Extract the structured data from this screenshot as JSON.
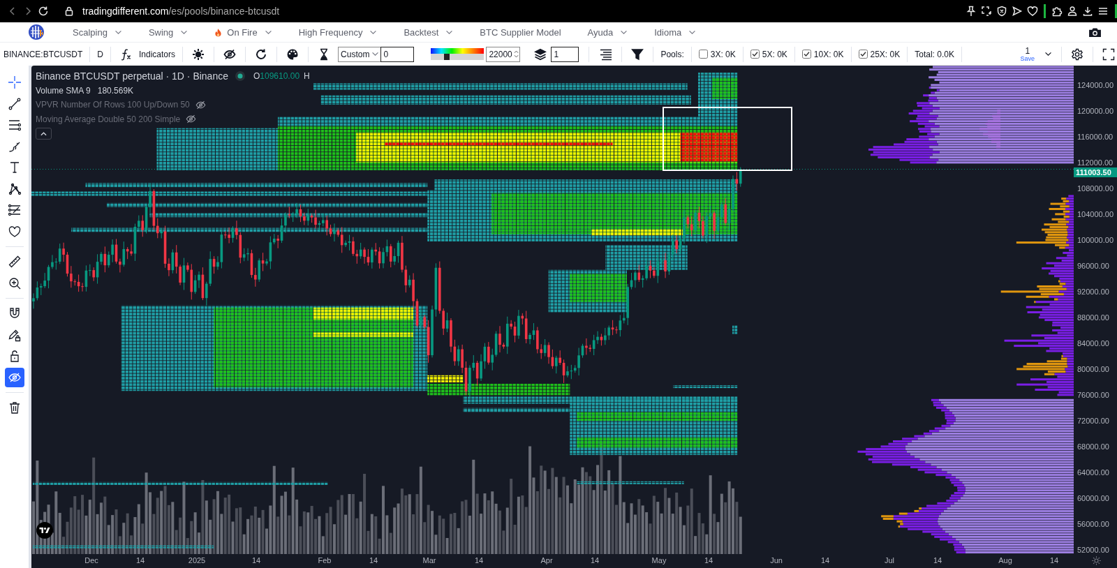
{
  "browser": {
    "url_host": "tradingdifferent.com",
    "url_path": "/es/pools/binance-btcusdt"
  },
  "nav": {
    "items": [
      {
        "label": "Scalping",
        "kind": "plain",
        "dropdown": true
      },
      {
        "label": "Swing",
        "kind": "plain",
        "dropdown": true
      },
      {
        "label": "On Fire",
        "kind": "hot",
        "dropdown": true
      },
      {
        "label": "High Frequency",
        "kind": "plain",
        "dropdown": true
      },
      {
        "label": "Backtest",
        "kind": "plain",
        "dropdown": true
      },
      {
        "label": "BTC Supplier Model",
        "kind": "plain",
        "dropdown": false
      },
      {
        "label": "Ayuda",
        "kind": "plain",
        "dropdown": true
      },
      {
        "label": "Idioma",
        "kind": "plain",
        "dropdown": true
      }
    ]
  },
  "toolbar": {
    "symbol": "BINANCE:BTCUSDT",
    "interval": "D",
    "indicators": "Indicators",
    "range_mode": "Custom",
    "range_value": "0",
    "color_scale": {
      "level": 0.3
    },
    "threshold": "22000",
    "layers": "1",
    "pools_label": "Pools:",
    "pools": [
      {
        "label": "3X: 0K",
        "checked": false
      },
      {
        "label": "5X: 0K",
        "checked": true
      },
      {
        "label": "10X: 0K",
        "checked": true
      },
      {
        "label": "25X: 0K",
        "checked": true
      }
    ],
    "total": "Total: 0.0K",
    "layout": {
      "number": "1",
      "action": "Save"
    }
  },
  "drawing_toolbar": {
    "groups": [
      {
        "tools": [
          {
            "kind": "crosshair",
            "selected": true
          },
          {
            "kind": "trend-line",
            "selected": false
          },
          {
            "kind": "parallel-lines",
            "selected": false
          },
          {
            "kind": "brush",
            "selected": false
          },
          {
            "kind": "text",
            "selected": false
          },
          {
            "kind": "pattern",
            "selected": false
          },
          {
            "kind": "projection",
            "selected": false
          },
          {
            "kind": "heart",
            "selected": false
          }
        ]
      },
      {
        "tools": [
          {
            "kind": "ruler",
            "selected": false
          },
          {
            "kind": "zoom",
            "selected": false
          }
        ]
      },
      {
        "tools": [
          {
            "kind": "magnet",
            "selected": false
          },
          {
            "kind": "lock-drawings",
            "selected": false
          },
          {
            "kind": "lock",
            "selected": false
          },
          {
            "kind": "hide-drawings",
            "selected": true
          }
        ]
      },
      {
        "tools": [
          {
            "kind": "trash",
            "selected": false
          }
        ]
      }
    ]
  },
  "chart": {
    "title": "Binance BTCUSDT perpetual · 1D · Binance",
    "market_open": true,
    "ohlc": [
      {
        "label": "O",
        "value": "109610.00"
      },
      {
        "label": "H"
      }
    ],
    "studies": [
      {
        "name": "Volume SMA 9",
        "value": "180.569K",
        "visible": true
      },
      {
        "name": "VPVR Number Of Rows 100 Up/Down 50",
        "visible": false
      },
      {
        "name": "Moving Average Double 50 200 Simple",
        "visible": false
      }
    ],
    "price_axis": [
      "124000.00",
      "120000.00",
      "116000.00",
      "112000.00",
      "108000.00",
      "104000.00",
      "100000.00",
      "96000.00",
      "92000.00",
      "88000.00",
      "84000.00",
      "80000.00",
      "76000.00",
      "72000.00",
      "68000.00",
      "64000.00",
      "60000.00",
      "56000.00",
      "52000.00"
    ],
    "last_price": "111003.50",
    "time_axis": [
      "Dec",
      "14",
      "2025",
      "14",
      "Feb",
      "14",
      "Mar",
      "14",
      "Apr",
      "14",
      "May",
      "14",
      "Jun",
      "14",
      "Jul",
      "14",
      "Aug",
      "14"
    ]
  }
}
